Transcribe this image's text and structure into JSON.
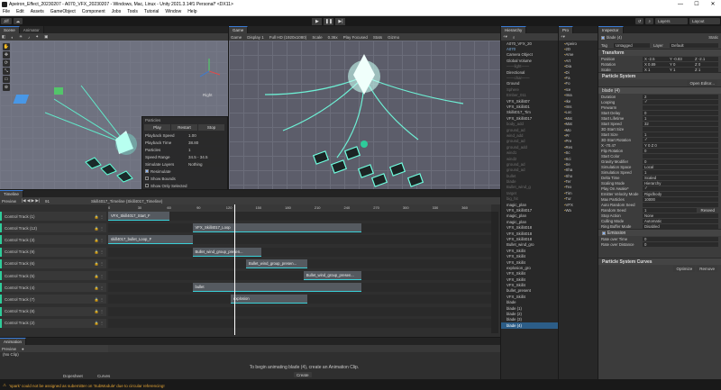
{
  "window": {
    "title": "Apeiron_Effect_20230207 - A070_VFX_20230207 - Windows, Mac, Linux - Unity 2021.3.14f1 Personal* <DX11>",
    "controls": [
      "—",
      "☐",
      "✕"
    ]
  },
  "menu": [
    "File",
    "Edit",
    "Assets",
    "GameObject",
    "Component",
    "Jobs",
    "Tools",
    "Tutorial",
    "Window",
    "Help"
  ],
  "toolbar": {
    "account": "Jiff",
    "layers": "Layers",
    "layout": "Layout"
  },
  "scene": {
    "tabs": [
      "Scene",
      "Animator"
    ],
    "tools": [
      "✋",
      "✥",
      "⟳",
      "⤡",
      "▭",
      "⊕"
    ],
    "axis_label": "Right",
    "particles_overlay": {
      "title": "Particles",
      "buttons": [
        "Play",
        "Restart",
        "Stop"
      ],
      "rows": [
        {
          "k": "Playback Speed",
          "v": "1.00"
        },
        {
          "k": "Playback Time",
          "v": "38.80"
        },
        {
          "k": "Particles",
          "v": "1"
        },
        {
          "k": "Speed Range",
          "v": "34.5 - 34.5"
        },
        {
          "k": "Simulate Layers",
          "v": "Nothing"
        }
      ],
      "checks": [
        {
          "label": "Resimulate",
          "on": true
        },
        {
          "label": "Show Bounds",
          "on": false
        },
        {
          "label": "Show Only Selected",
          "on": false
        }
      ]
    }
  },
  "game": {
    "tab": "Game",
    "toolbar": [
      "Game",
      "Display 1",
      "Full HD (1920x1080)",
      "Scale",
      "0.36x",
      "Play Focused",
      "Stats",
      "Gizmo"
    ]
  },
  "hierarchy": {
    "tab": "Hierarchy",
    "items": [
      {
        "t": "A070_VFX_20",
        "c": ""
      },
      {
        "t": "A070",
        "c": "blue"
      },
      {
        "t": "Camera Object",
        "c": ""
      },
      {
        "t": "Global Volume",
        "c": ""
      },
      {
        "t": "——light——",
        "c": "grey"
      },
      {
        "t": "Directional",
        "c": ""
      },
      {
        "t": "——char——",
        "c": "grey"
      },
      {
        "t": "Ground",
        "c": ""
      },
      {
        "t": "Sphere",
        "c": "grey"
      },
      {
        "t": "Ember_011",
        "c": "grey"
      },
      {
        "t": "VFX_Skill407",
        "c": ""
      },
      {
        "t": "VFX_Skill401",
        "c": ""
      },
      {
        "t": "Skill4017_Tim",
        "c": ""
      },
      {
        "t": "VFX_Skill4017",
        "c": ""
      },
      {
        "t": "body_add",
        "c": "grey"
      },
      {
        "t": "ground_ad",
        "c": "grey"
      },
      {
        "t": "wind_add",
        "c": "grey"
      },
      {
        "t": "ground_ad",
        "c": "grey"
      },
      {
        "t": "ground_add",
        "c": "grey"
      },
      {
        "t": "wind1",
        "c": "grey"
      },
      {
        "t": "wind2",
        "c": "grey"
      },
      {
        "t": "ground_ad",
        "c": "grey"
      },
      {
        "t": "ground_ad",
        "c": "grey"
      },
      {
        "t": "bullet",
        "c": "grey"
      },
      {
        "t": "blade",
        "c": "grey"
      },
      {
        "t": "Bullet_wind_g",
        "c": "grey"
      },
      {
        "t": "target",
        "c": "grey"
      },
      {
        "t": "big_hit",
        "c": "grey"
      },
      {
        "t": "magic_plan",
        "c": ""
      },
      {
        "t": "VFX_Skill4017",
        "c": ""
      },
      {
        "t": "magic_plan",
        "c": ""
      },
      {
        "t": "magic_plan",
        "c": ""
      },
      {
        "t": "VFX_Skill4018",
        "c": ""
      },
      {
        "t": "VFX_Skill4018",
        "c": ""
      },
      {
        "t": "VFX_Skill4018",
        "c": ""
      },
      {
        "t": "Bullet_wind_gro",
        "c": ""
      },
      {
        "t": "VFX_Skill4",
        "c": ""
      },
      {
        "t": "VFX_Skill4",
        "c": ""
      },
      {
        "t": "VFX_Skill4",
        "c": ""
      },
      {
        "t": "explosion_gro",
        "c": ""
      },
      {
        "t": "VFX_Skill4",
        "c": ""
      },
      {
        "t": "VFX_Skill4",
        "c": ""
      },
      {
        "t": "VFX_Skill4",
        "c": ""
      },
      {
        "t": "bullet_present",
        "c": ""
      },
      {
        "t": "VFX_Skill4",
        "c": ""
      },
      {
        "t": "blade",
        "c": ""
      },
      {
        "t": "blade (1)",
        "c": ""
      },
      {
        "t": "blade (2)",
        "c": ""
      },
      {
        "t": "blade (3)",
        "c": ""
      },
      {
        "t": "blade (4)",
        "c": "sel"
      }
    ]
  },
  "project": {
    "tab": "Pro",
    "items": [
      "Apeiro",
      "2D",
      "Ame",
      "Art",
      "Dia",
      "Di",
      "Fa",
      "Fo",
      "Ice",
      "Ima",
      "Ike",
      "Ims",
      "Loc",
      "Mat",
      "Mat",
      "Mo",
      "Pr",
      "Pre",
      "Res",
      "Sc",
      "Sci",
      "Se",
      "Sha",
      "Sho",
      "Ter",
      "Tex",
      "Tim",
      "Tur",
      "VFX",
      "Wa"
    ]
  },
  "inspector": {
    "tab": "Inspector",
    "object_name": "blade (4)",
    "static_label": "Static",
    "tag": "Untagged",
    "layer": "Default",
    "transform": {
      "title": "Transform",
      "position": [
        "X -2.5",
        "Y -0.83",
        "Z -2.1"
      ],
      "rotation": [
        "X 0.89",
        "Y 0",
        "Z 0"
      ],
      "scale": [
        "X 1",
        "Y 1",
        "Z 1"
      ]
    },
    "ps_title": "Particle System",
    "open_editor": "Open Editor...",
    "module": "blade (4)",
    "props": [
      {
        "k": "Duration",
        "v": "2"
      },
      {
        "k": "Looping",
        "v": "✓"
      },
      {
        "k": "Prewarm",
        "v": ""
      },
      {
        "k": "Start Delay",
        "v": "0"
      },
      {
        "k": "Start Lifetime",
        "v": "1"
      },
      {
        "k": "Start Speed",
        "v": "32"
      },
      {
        "k": "3D Start Size",
        "v": ""
      },
      {
        "k": "Start Size",
        "v": "1"
      },
      {
        "k": "3D Start Rotation",
        "v": "✓"
      },
      {
        "k": "X -70.47",
        "v": "Y 0   Z 0"
      },
      {
        "k": "Flip Rotation",
        "v": "0"
      },
      {
        "k": "Start Color",
        "v": ""
      },
      {
        "k": "Gravity Modifier",
        "v": "0"
      },
      {
        "k": "Simulation Space",
        "v": "Local"
      },
      {
        "k": "Simulation Speed",
        "v": "1"
      },
      {
        "k": "Delta Time",
        "v": "Scaled"
      },
      {
        "k": "Scaling Mode",
        "v": "Hierarchy"
      },
      {
        "k": "Play On Awake*",
        "v": "✓"
      },
      {
        "k": "Emitter Velocity Mode",
        "v": "Rigidbody"
      },
      {
        "k": "Max Particles",
        "v": "10000"
      },
      {
        "k": "Auto Random Seed",
        "v": ""
      },
      {
        "k": "Random Seed",
        "v": "1"
      },
      {
        "k": "Stop Action",
        "v": "None"
      },
      {
        "k": "Culling Mode",
        "v": "Automatic"
      },
      {
        "k": "Ring Buffer Mode",
        "v": "Disabled"
      }
    ],
    "reseed": "Reseed",
    "emission": "Emission",
    "rate_time": {
      "k": "Rate over Time",
      "v": "0"
    },
    "rate_dist": {
      "k": "Rate over Distance",
      "v": "0"
    },
    "curves_title": "Particle System Curves",
    "optimize": "Optimize",
    "remove": "Remove"
  },
  "timeline": {
    "tab": "Timeline",
    "preview": "Preview",
    "frame": "91",
    "asset": "Skill4017_Timeline (Skill4017_Timeline)",
    "ticks": [
      "0",
      "30",
      "60",
      "90",
      "120",
      "150",
      "180",
      "210",
      "240",
      "270",
      "300",
      "330",
      "360"
    ],
    "tracks": [
      "Control Track (1)",
      "Control Track (12)",
      "Control Track (3)",
      "Control Track (9)",
      "Control Track (6)",
      "Control Track (5)",
      "Control Track (4)",
      "Control Track (7)",
      "Control Track (8)",
      "Control Track (2)"
    ],
    "clips": [
      {
        "label": "VFX_Skill4017_Start_F",
        "track": 0,
        "start": 0,
        "end": 0.16
      },
      {
        "label": "VFX_Skill4017_Loop",
        "track": 1,
        "start": 0.22,
        "end": 0.66
      },
      {
        "label": "skill4017_bullet_Loop_F",
        "track": 2,
        "start": 0,
        "end": 0.22
      },
      {
        "label": "Bullet_wind_group_presen...",
        "track": 3,
        "start": 0.22,
        "end": 0.4
      },
      {
        "label": "Bullet_wind_group_presen...",
        "track": 4,
        "start": 0.36,
        "end": 0.52
      },
      {
        "label": "Bullet_wind_group_presen...",
        "track": 5,
        "start": 0.51,
        "end": 0.66
      },
      {
        "label": "bullet",
        "track": 6,
        "start": 0.22,
        "end": 0.66
      },
      {
        "label": "explosion",
        "track": 7,
        "start": 0.32,
        "end": 0.52
      }
    ],
    "playhead": 0.33
  },
  "animation": {
    "tab": "Animation",
    "preview": "Preview",
    "no_clip": "(No Clip)",
    "message": "To begin animating blade (4), create an Animation Clip.",
    "create": "Create",
    "dopesheet": "Dopesheet",
    "curves": "Curves"
  },
  "status": {
    "message": "'spark' could not be assigned as subemitter on 'SubModule' due to circular referencing!"
  },
  "colors": {
    "accent": "#3a7bd5",
    "track": "#2ecc9a",
    "clip_edge": "#39d0d8",
    "warning": "#e2a335"
  }
}
